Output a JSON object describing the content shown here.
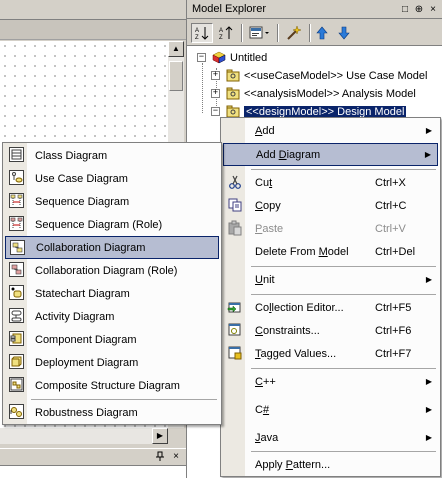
{
  "explorer": {
    "title": "Model Explorer",
    "title_buttons": [
      "□",
      "⊕",
      "×"
    ],
    "tree": [
      {
        "label": "Untitled",
        "icon": "project-cube-icon",
        "level": 0,
        "expander": "−"
      },
      {
        "label": "<<useCaseModel>> Use Case Model",
        "icon": "folder-model-icon",
        "level": 1,
        "expander": "+"
      },
      {
        "label": "<<analysisModel>> Analysis Model",
        "icon": "folder-model-icon",
        "level": 1,
        "expander": "+"
      },
      {
        "label": "<<designModel>> Design Model",
        "icon": "folder-model-icon",
        "level": 1,
        "expander": "−",
        "selected": true
      }
    ]
  },
  "bottom_panel": {
    "pin": "ᵖ",
    "close": "×"
  },
  "context_menu": {
    "items": [
      {
        "label": "Add",
        "ul": "A",
        "submenu": true
      },
      {
        "label": "Add Diagram",
        "ul": "D",
        "submenu": true,
        "highlighted": true
      },
      {
        "sep": true
      },
      {
        "label": "Cut",
        "ul": "t",
        "shortcut": "Ctrl+X",
        "icon": "scissors-icon"
      },
      {
        "label": "Copy",
        "ul": "C",
        "shortcut": "Ctrl+C",
        "icon": "copy-icon"
      },
      {
        "label": "Paste",
        "ul": "P",
        "shortcut": "Ctrl+V",
        "icon": "paste-icon",
        "disabled": true
      },
      {
        "label": "Delete From Model",
        "ul": "M",
        "shortcut": "Ctrl+Del"
      },
      {
        "sep": true
      },
      {
        "label": "Unit",
        "ul": "U",
        "submenu": true
      },
      {
        "sep": true
      },
      {
        "label": "Collection Editor...",
        "ul": "l",
        "shortcut": "Ctrl+F5",
        "icon": "collection-editor-icon"
      },
      {
        "label": "Constraints...",
        "ul": "C",
        "shortcut": "Ctrl+F6",
        "icon": "constraints-icon"
      },
      {
        "label": "Tagged Values...",
        "ul": "T",
        "shortcut": "Ctrl+F7",
        "icon": "tagged-values-icon"
      },
      {
        "sep": true
      },
      {
        "label": "C++",
        "ul": "C",
        "submenu": true
      },
      {
        "label": "C#",
        "ul": "#",
        "submenu": true
      },
      {
        "label": "Java",
        "ul": "J",
        "submenu": true
      },
      {
        "sep": true
      },
      {
        "label": "Apply Pattern...",
        "ul": "P"
      }
    ]
  },
  "diagram_submenu": {
    "items": [
      {
        "label": "Class Diagram",
        "icon": "class-diagram-icon"
      },
      {
        "label": "Use Case Diagram",
        "icon": "use-case-diagram-icon"
      },
      {
        "label": "Sequence Diagram",
        "icon": "sequence-diagram-icon"
      },
      {
        "label": "Sequence Diagram (Role)",
        "icon": "sequence-role-diagram-icon"
      },
      {
        "label": "Collaboration Diagram",
        "icon": "collaboration-diagram-icon",
        "highlighted": true
      },
      {
        "label": "Collaboration Diagram (Role)",
        "icon": "collaboration-role-diagram-icon"
      },
      {
        "label": "Statechart Diagram",
        "icon": "statechart-diagram-icon"
      },
      {
        "label": "Activity Diagram",
        "icon": "activity-diagram-icon"
      },
      {
        "label": "Component Diagram",
        "icon": "component-diagram-icon"
      },
      {
        "label": "Deployment Diagram",
        "icon": "deployment-diagram-icon"
      },
      {
        "label": "Composite Structure Diagram",
        "icon": "composite-structure-diagram-icon"
      },
      {
        "sep": true
      },
      {
        "label": "Robustness Diagram",
        "icon": "robustness-diagram-icon"
      }
    ]
  },
  "colors": {
    "highlight_bg": "#b6bdd2",
    "highlight_border": "#0a246a",
    "selection": "#0a246a"
  }
}
